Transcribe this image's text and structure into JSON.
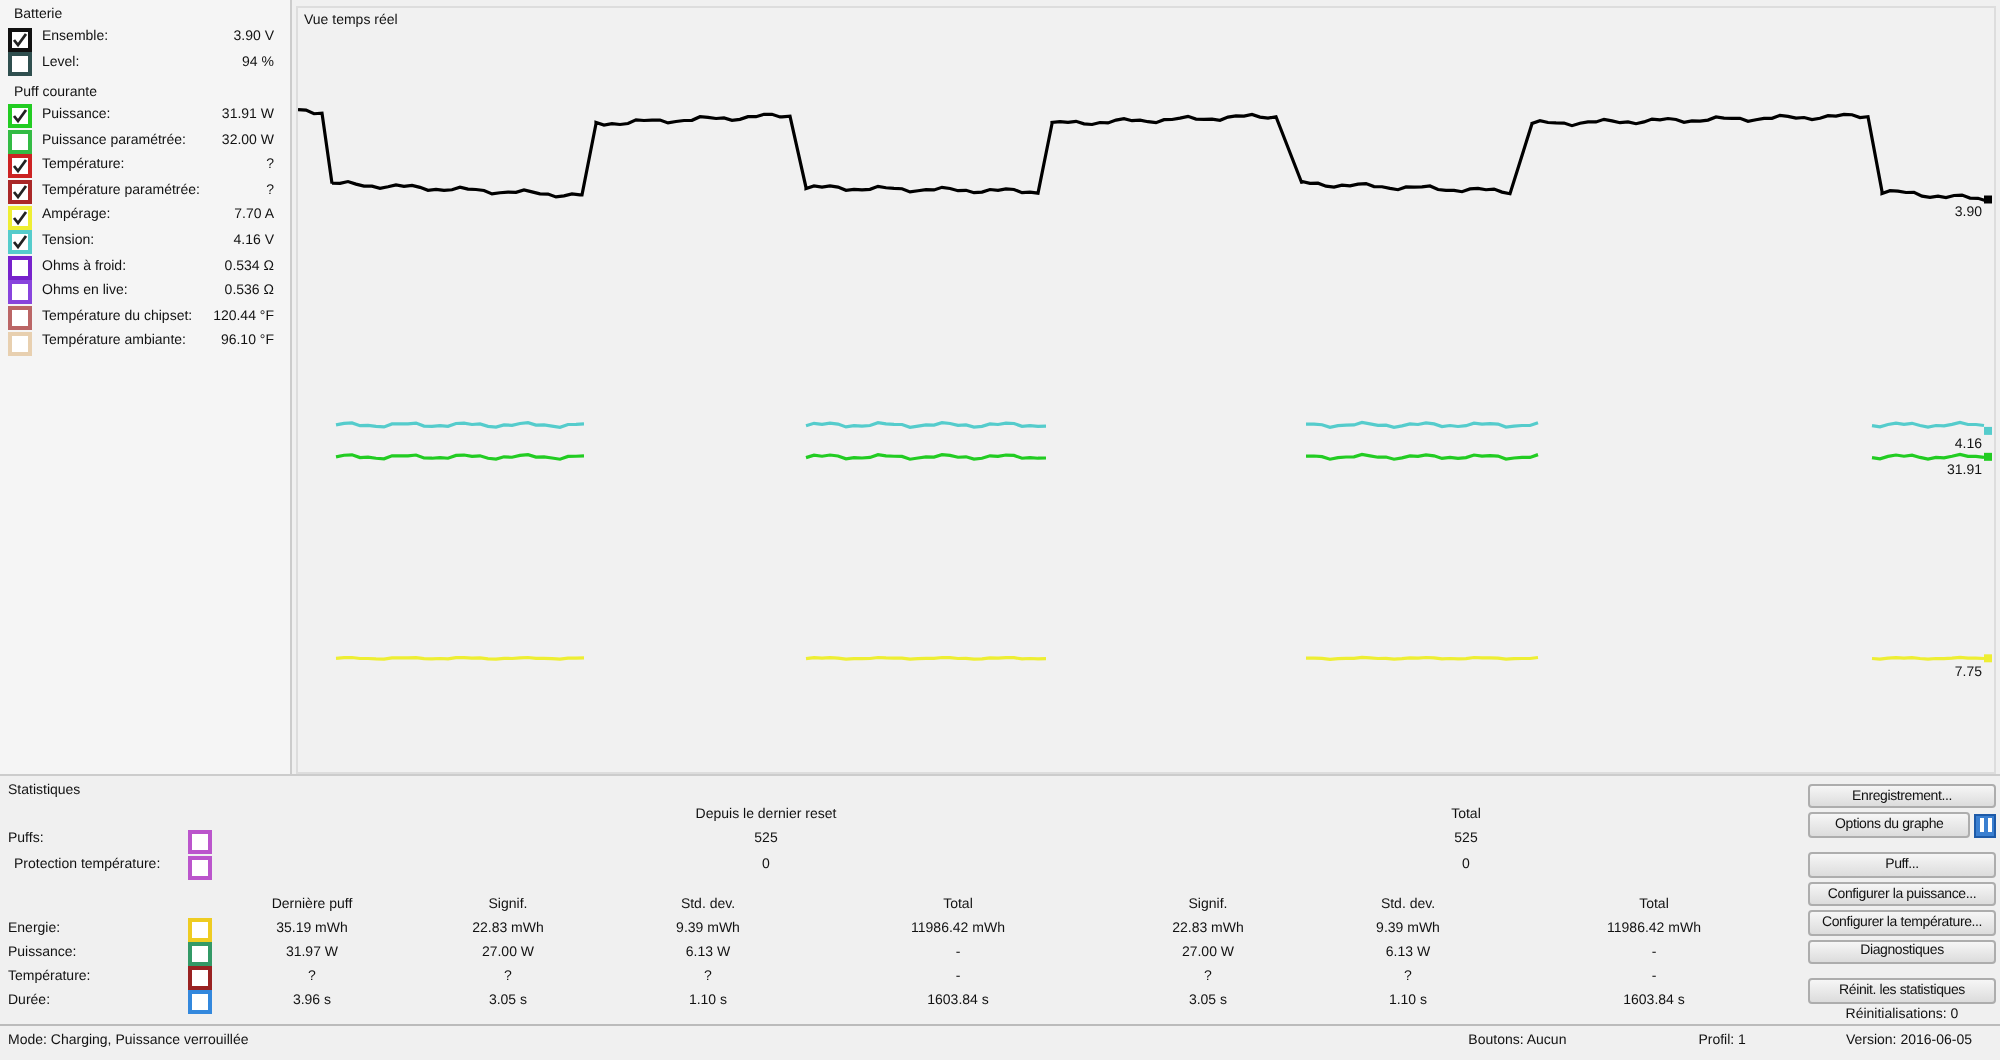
{
  "sidebar": {
    "groups": [
      {
        "title": "Batterie",
        "items": [
          {
            "label": "Ensemble:",
            "value": "3.90 V",
            "color": "#111111",
            "checked": true
          },
          {
            "label": "Level:",
            "value": "94 %",
            "color": "#2f4f4f",
            "checked": false
          }
        ]
      },
      {
        "title": "Puff courante",
        "items": [
          {
            "label": "Puissance:",
            "value": "31.91 W",
            "color": "#22cc22",
            "checked": true
          },
          {
            "label": "Puissance paramétrée:",
            "value": "32.00 W",
            "color": "#33bb44",
            "checked": false
          },
          {
            "label": "Température:",
            "value": "?",
            "color": "#cc2222",
            "checked": true
          },
          {
            "label": "Température paramétrée:",
            "value": "?",
            "color": "#aa2828",
            "checked": true
          },
          {
            "label": "Ampérage:",
            "value": "7.70 A",
            "color": "#eeee33",
            "checked": true
          },
          {
            "label": "Tension:",
            "value": "4.16 V",
            "color": "#55cccc",
            "checked": true
          },
          {
            "label": "Ohms à froid:",
            "value": "0.534 Ω",
            "color": "#7722cc",
            "checked": false
          },
          {
            "label": "Ohms en live:",
            "value": "0.536 Ω",
            "color": "#8844dd",
            "checked": false
          },
          {
            "label": "Température du chipset:",
            "value": "120.44 °F",
            "color": "#bb6666",
            "checked": false
          },
          {
            "label": "Température ambiante:",
            "value": "96.10 °F",
            "color": "#e8d0b0",
            "checked": false
          }
        ]
      }
    ]
  },
  "graph": {
    "title": "Vue temps réel",
    "traces": [
      {
        "label": "3.90",
        "color": "#000000"
      },
      {
        "label": "4.16",
        "color": "#55cccc"
      },
      {
        "label": "31.91",
        "color": "#22cc22"
      },
      {
        "label": "7.75",
        "color": "#eeee33"
      }
    ]
  },
  "statistics": {
    "title": "Statistiques",
    "since_reset_header": "Depuis le dernier reset",
    "total_header": "Total",
    "counters": [
      {
        "label": "Puffs:",
        "color": "#bb55cc",
        "checked": false,
        "since_reset": "525",
        "total": "525"
      },
      {
        "label": "Protection température:",
        "color": "#bb55cc",
        "checked": false,
        "since_reset": "0",
        "total": "0"
      }
    ],
    "columns": [
      "Dernière puff",
      "Signif.",
      "Std. dev.",
      "Total",
      "Signif.",
      "Std. dev.",
      "Total"
    ],
    "rows": [
      {
        "label": "Energie:",
        "color": "#eecc22",
        "checked": false,
        "cells": [
          "35.19 mWh",
          "22.83 mWh",
          "9.39 mWh",
          "11986.42 mWh",
          "22.83 mWh",
          "9.39 mWh",
          "11986.42 mWh"
        ]
      },
      {
        "label": "Puissance:",
        "color": "#339966",
        "checked": false,
        "cells": [
          "31.97 W",
          "27.00 W",
          "6.13 W",
          "-",
          "27.00 W",
          "6.13 W",
          "-"
        ]
      },
      {
        "label": "Température:",
        "color": "#992222",
        "checked": false,
        "cells": [
          "?",
          "?",
          "?",
          "-",
          "?",
          "?",
          "-"
        ]
      },
      {
        "label": "Durée:",
        "color": "#3388dd",
        "checked": false,
        "cells": [
          "3.96 s",
          "3.05 s",
          "1.10 s",
          "1603.84 s",
          "3.05 s",
          "1.10 s",
          "1603.84 s"
        ]
      }
    ]
  },
  "buttons": [
    {
      "label": "Enregistrement...",
      "kind": "button"
    },
    {
      "label": "Options du graphe",
      "kind": "toggle",
      "paused": true
    },
    {
      "label": "Puff...",
      "kind": "button",
      "gap": true
    },
    {
      "label": "Configurer la puissance...",
      "kind": "button"
    },
    {
      "label": "Configurer la température...",
      "kind": "button"
    },
    {
      "label": "Diagnostiques",
      "kind": "button"
    },
    {
      "label": "Réinit. les statistiques",
      "kind": "button",
      "gap": true
    }
  ],
  "reset_count": "Réinitialisations: 0",
  "status_bar": {
    "mode": "Mode: Charging, Puissance verrouillée",
    "buttons": "Boutons: Aucun",
    "profile": "Profil: 1",
    "version": "Version: 2016-06-05"
  }
}
